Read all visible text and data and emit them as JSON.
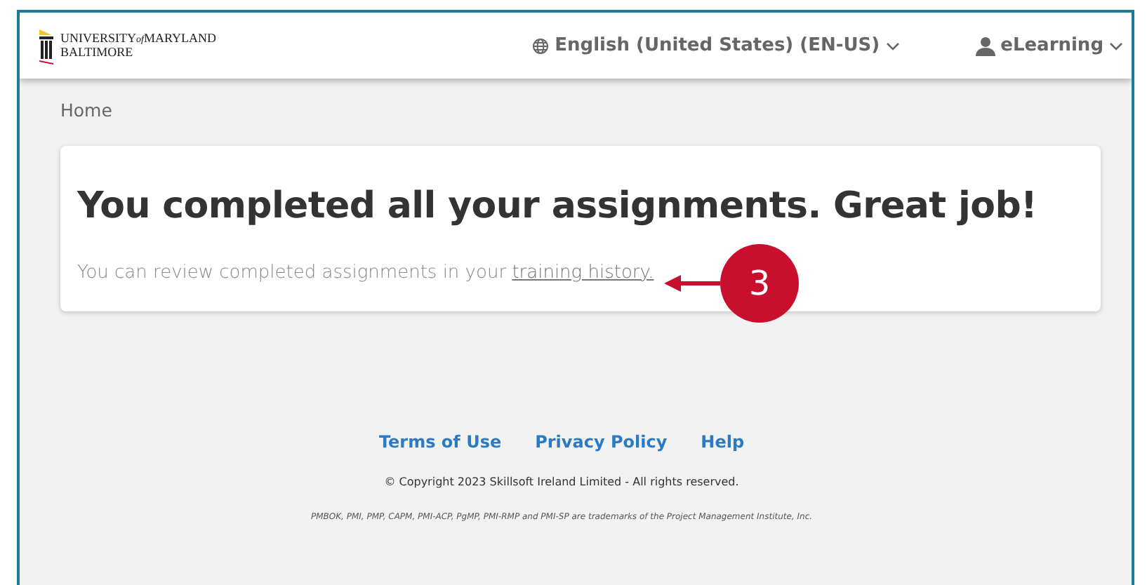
{
  "header": {
    "logo": {
      "line_1": "UNIVERSITY",
      "of": "of",
      "line_1b": "MARYLAND",
      "line_2": "BALTIMORE"
    },
    "language": "English (United States) (EN-US)",
    "user": "eLearning"
  },
  "breadcrumb": "Home",
  "card": {
    "title": "You completed all your assignments. Great job!",
    "text": "You can review completed assignments in your",
    "link": "training history."
  },
  "callout": {
    "label": "3"
  },
  "footer": {
    "links": [
      "Terms of Use",
      "Privacy Policy",
      "Help"
    ],
    "copyright": "© Copyright 2023 Skillsoft Ireland Limited - All rights reserved.",
    "trademark": "PMBOK, PMI, PMP, CAPM, PMI-ACP, PgMP, PMI-RMP and PMI-SP are trademarks of the Project Management Institute, Inc."
  }
}
